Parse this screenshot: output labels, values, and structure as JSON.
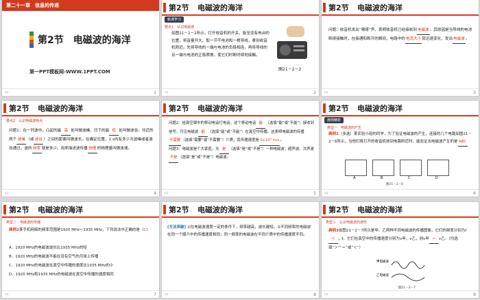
{
  "slides": [
    {
      "number": "1",
      "chapter": "第二十一章　信息的传递",
      "section_title": "第2节　电磁波的海洋",
      "website": "第一PPT模板网-WWW.1PPT.COM"
    },
    {
      "number": "2",
      "section": "第2节",
      "title": "电磁波的海洋",
      "tag": "新课学习",
      "sub": "要点1　认识电磁波",
      "para": "如图21－2－2所示，打开收音机的开关，旋至没有电台的位置，将音量开大。取一节干电池和一根导线，拿到收音机附近。先将导线的一端与电池的负极相连，再将导线的另一端与电池的正极摩擦，使它们时断时续地接触。",
      "figure_caption": "图21－2－2"
    },
    {
      "number": "3",
      "section": "第2节",
      "title": "电磁波的海洋",
      "q_prefix": "问题：收音机发出“喀喀”声，表明收音机已经接收到",
      "b1": "电磁波",
      "q_mid": "。其原因是当导线的电池断续接触时，在接通和断开的瞬间，电路中的",
      "b2": "电流大小",
      "q_mid2": "就迅速变化，发出",
      "b3": "电磁波",
      "q_end": "。"
    },
    {
      "number": "4",
      "section": "第2节",
      "title": "电磁波的海洋",
      "sub": "要点2　认识电磁波特点",
      "q1_a": "问题1：在一列波中，凸起的最",
      "b1": "高",
      "q1_b": "处叫做波峰，凹下的最",
      "b2": "低",
      "q1_c": "处叫做波谷。邻近的两个",
      "b3": "波峰",
      "q1_d": "（或",
      "b4": "波谷",
      "q1_e": "）之间的距离叫做波长。在确定位置，1 s内有多少次波峰或者波谷通过，波的",
      "b5": "频率",
      "q1_f": "就是多少。用来描述波传播",
      "b6": "快慢",
      "q1_g": "的物理量叫做波速。"
    },
    {
      "number": "5",
      "section": "第2节",
      "title": "电磁波的海洋",
      "q2_a": "问题2：给真空罩中的移动电话打电话，这个移动电话",
      "b1": "能",
      "q2_b": "（选填“能”或“不能”）接收到信号。可见电磁波",
      "b2": "能",
      "q2_c": "（选填“能”或“不能”）在真空中传播。这表明电磁波的传播",
      "b3": "不需要",
      "q2_d": "（选填“需要”或“不需要”）介质，其传播速度是",
      "b4": "3×10⁸ m/s",
      "q2_e": "。",
      "q3_a": "问题3：电磁波是个大家庭，光",
      "b5": "是",
      "q3_b": "（选填“是”或“不是”）一种电磁波；超声波、次声波",
      "b6": "不是",
      "q3_c": "（选填“是”或“不是”）电磁波。"
    },
    {
      "number": "6",
      "section": "第2节",
      "title": "电磁波的海洋",
      "tag": "典例精析",
      "sub": "类型一　电磁波的产生",
      "ex_label": "典例1",
      "ex_text": "（多选）某实验小组的同学，为了验证电磁波的产生，连接的几个电路如图21－2－6所示，当他们将打开的收音机放到电路附近时，能验证出电磁波产生的是",
      "answer": "ABC",
      "fig_labels": [
        "A",
        "B",
        "C",
        "D"
      ],
      "figure_caption": "图21－2－6"
    },
    {
      "number": "7",
      "section": "第2节",
      "title": "电磁波的海洋",
      "sub": "类型二　电磁波的传播",
      "ex_label": "典例2",
      "ex_text": "某手机网络的频率范围是1920 MHz～1935 MHz，下列说法中正确的是（",
      "answer": "C",
      "ex_end": "）",
      "options": [
        "A．1920 MHz的电磁波波长比1935 MHz的短",
        "B．1920 MHz的电磁波不能在没有空气的月球上传播",
        "C．1920 MHz的电磁波在真空中传播的速度比1935 MHz的小",
        "D．1920 MHz和1935 MHz的电磁波在真空中传播的速度相同"
      ]
    },
    {
      "number": "8",
      "section": "第2节",
      "title": "电磁波的海洋",
      "note_label": "[方法突破]",
      "note": "①在电磁波速度一定的条件下，频率越高，波长越短。②不同频率的电磁波在同一个媒介中的传播速度相同；同一频率的电磁波在不同介质中的传播速度不同。"
    },
    {
      "number": "9",
      "section": "第2节",
      "title": "电磁波的海洋",
      "sub": "类型三　认识电磁波的波形",
      "ex_label": "典例3",
      "ex_a": "如图21－2－7所示是甲、乙两种不同电磁波的传播图像，它们的频率分别为f",
      "b1": "＜",
      "ex_b": "，f。它们在真空中的传播速度分别为v甲、v乙，则v甲",
      "b2": "＝",
      "ex_c": "v乙。（均选填“＞”“＝”或“＜”）",
      "wave_labels": [
        "甲电磁波",
        "乙电磁波"
      ],
      "figure_caption": "图21－2－7"
    }
  ],
  "colors": {
    "accent": "#d23a1f",
    "background": "#d9d9d9"
  }
}
